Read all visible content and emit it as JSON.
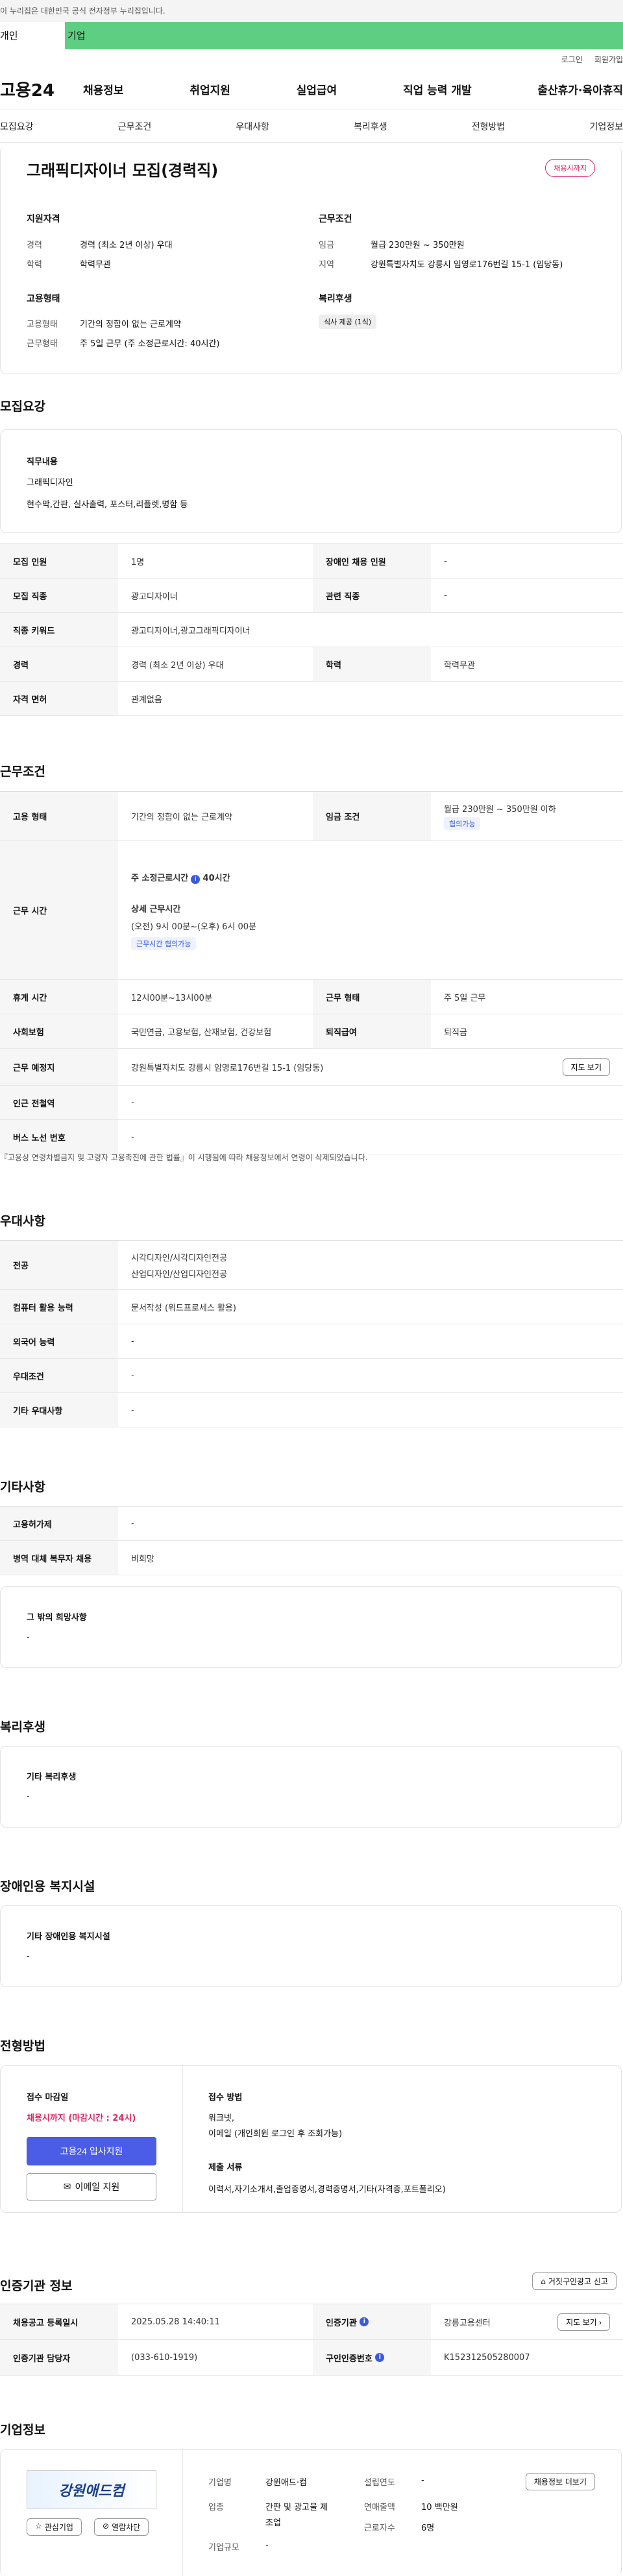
{
  "gov_banner": "이 누리집은 대한민국 공식 전자정부 누리집입니다.",
  "user_tabs": [
    "개인",
    "기업"
  ],
  "util": [
    "로그인",
    "회원가입"
  ],
  "logo": "고용24",
  "gnb": [
    "채용정보",
    "취업지원",
    "실업급여",
    "직업 능력 개발",
    "출산휴가·육아휴직"
  ],
  "subnav": [
    "모집요강",
    "근무조건",
    "우대사항",
    "복리후생",
    "전형방법",
    "기업정보"
  ],
  "job": {
    "title": "그래픽디자이너 모집(경력직)",
    "badge": "채용시까지",
    "qual_h": "지원자격",
    "work_h": "근무조건",
    "emp_h": "고용형태",
    "benefit_h": "복리후생",
    "career_l": "경력",
    "career_v": "경력 (최소 2년 이상) 우대",
    "edu_l": "학력",
    "edu_v": "학력무관",
    "wage_l": "임금",
    "wage_v": "월급 230만원 ~ 350만원",
    "region_l": "지역",
    "region_v": "강원특별자치도 강릉시 임영로176번길 15-1 (임당동)",
    "etype_l": "고용형태",
    "etype_v": "기간의 정함이 없는 근로계약",
    "wtype_l": "근무형태",
    "wtype_v": "주 5일 근무 (주 소정근로시간: 40시간)",
    "benefit_tag": "식사 제공 (1식)"
  },
  "recruit": {
    "title": "모집요강",
    "duty_h": "직무내용",
    "duty1": "그래픽디자인",
    "duty2": "현수막,간판, 실사출력, 포스터,리플렛,명함 등",
    "rows": [
      [
        "모집 인원",
        "1명",
        "장애인 채용 인원",
        "-"
      ],
      [
        "모집 직종",
        "광고디자이너",
        "관련 직종",
        "-"
      ]
    ],
    "kw_l": "직종 키워드",
    "kw_v": "광고디자이너,광고그래픽디자이너",
    "car_l": "경력",
    "car_v": "경력 (최소 2년 이상) 우대",
    "edu_l": "학력",
    "edu_v": "학력무관",
    "lic_l": "자격 면허",
    "lic_v": "관계없음"
  },
  "cond": {
    "title": "근무조건",
    "etype_l": "고용 형태",
    "etype_v": "기간의 정함이 없는 근로계약",
    "wage_l": "임금 조건",
    "wage_v": "월급 230만원 ~ 350만원 이하",
    "wage_tag": "협의가능",
    "time_l": "근무 시간",
    "time_a": "주 소정근로시간",
    "time_b": "40시간",
    "time_c": "상세 근무시간",
    "time_d": "(오전) 9시 00분~(오후) 6시 00분",
    "time_tag": "근무시간 협의가능",
    "rest_l": "휴게 시간",
    "rest_v": "12시00분~13시00분",
    "wtype_l": "근무 형태",
    "wtype_v": "주 5일 근무",
    "ins_l": "사회보험",
    "ins_v": "국민연금, 고용보험, 산재보험, 건강보험",
    "sev_l": "퇴직급여",
    "sev_v": "퇴직금",
    "place_l": "근무 예정지",
    "place_v": "강원특별자치도 강릉시 임영로176번길 15-1 (임당동)",
    "map": "지도 보기",
    "sub_l": "인근 전철역",
    "sub_v": "-",
    "bus_l": "버스 노선 번호",
    "bus_v": "-",
    "note": "『고용상 연령차별금지 및 고령자 고용촉진에 관한 법률』이 시행됨에 따라 채용정보에서 연령이 삭제되었습니다."
  },
  "pref": {
    "title": "우대사항",
    "major_l": "전공",
    "major_v1": "시각디자인/시각디자인전공",
    "major_v2": "산업디자인/산업디자인전공",
    "pc_l": "컴퓨터 활용 능력",
    "pc_v": "문서작성 (워드프로세스 활용)",
    "lang_l": "외국어 능력",
    "lang_v": "-",
    "cond_l": "우대조건",
    "cond_v": "-",
    "etc_l": "기타 우대사항",
    "etc_v": "-"
  },
  "other": {
    "title": "기타사항",
    "emp_l": "고용허가제",
    "emp_v": "-",
    "mil_l": "병역 대체 복무자 채용",
    "mil_v": "비희망",
    "hope_h": "그 밖의 희망사항",
    "hope_v": "-"
  },
  "welfare": {
    "title": "복리후생",
    "h": "기타 복리후생",
    "v": "-"
  },
  "disab": {
    "title": "장애인용 복지시설",
    "h": "기타 장애인용 복지시설",
    "v": "-"
  },
  "select": {
    "title": "전형방법",
    "dl_h": "접수 마감일",
    "dl_v": "채용시까지 (마감시간 : 24시)",
    "apply": "고용24 입사지원",
    "email": "이메일 지원",
    "method_h": "접수 방법",
    "method_v1": "워크넷,",
    "method_v2": "이메일 (개인회원 로그인 후 조회가능)",
    "docs_h": "제출 서류",
    "docs_v": "이력서,자기소개서,졸업증명서,경력증명서,기타(자격증,포트폴리오)"
  },
  "agency": {
    "title": "인증기관 정보",
    "report": "거짓구인광고 신고",
    "reg_l": "채용공고 등록일시",
    "reg_v": "2025.05.28 14:40:11",
    "org_l": "인증기관",
    "org_v": "강릉고용센터",
    "map": "지도 보기",
    "mgr_l": "인증기관 담당자",
    "mgr_v": "(033-610-1919)",
    "num_l": "구인인증번호",
    "num_v": "K152312505280007"
  },
  "company": {
    "title": "기업정보",
    "logo_text": "강원애드컴",
    "fav": "관심기업",
    "block": "열람차단",
    "name_l": "기업명",
    "name_v": "강원애드·컴",
    "year_l": "설립연도",
    "year_v": "-",
    "more": "채용정보 더보기",
    "ind_l": "업종",
    "ind_v1": "간판 및 광고물 제",
    "ind_v2": "조업",
    "sales_l": "연매출액",
    "sales_v": "10 백만원",
    "size_l": "기업규모",
    "size_v": "-",
    "emp_l": "근로자수",
    "emp_v": "6명"
  }
}
